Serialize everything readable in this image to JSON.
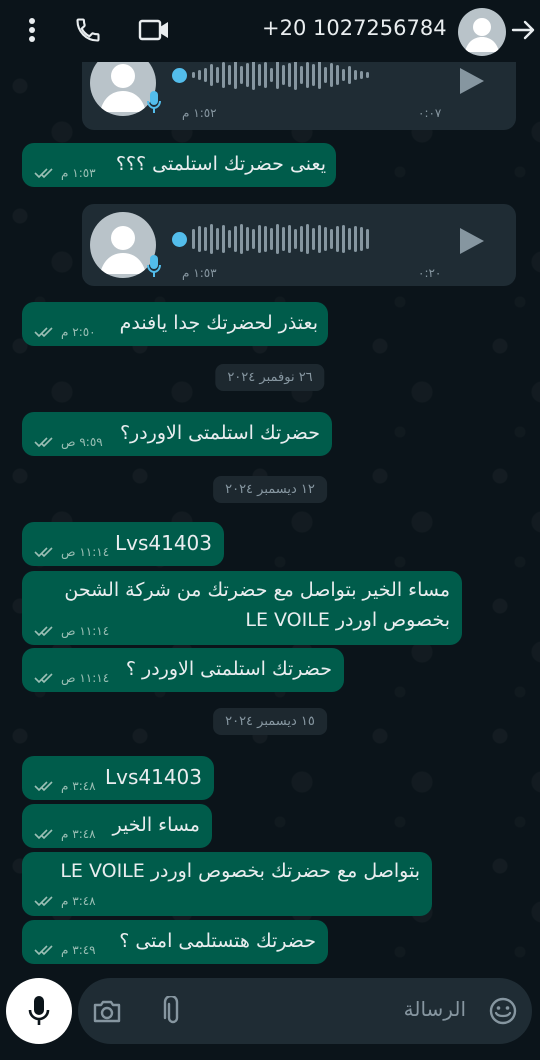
{
  "header": {
    "phone_number": "+20 1027256784",
    "icons": [
      "more-vert-icon",
      "phone-icon",
      "video-icon",
      "avatar",
      "arrow-icon"
    ]
  },
  "messages": {
    "voice1": {
      "duration": "٠:٠٧",
      "time": "١:٥٢ م"
    },
    "m1": {
      "text": "يعنى حضرتك استلمتى ؟؟؟",
      "time": "١:٥٣ م"
    },
    "voice2": {
      "duration": "٠:٢٠",
      "time": "١:٥٣ م"
    },
    "m2": {
      "text": "بعتذر لحضرتك جدا يافندم",
      "time": "٢:٥٠ م"
    },
    "date1": "٢٦ نوفمبر ٢٠٢٤",
    "m3": {
      "text": "حضرتك استلمتى الاوردر؟",
      "time": "٩:٥٩ ص"
    },
    "date2": "١٢ ديسمبر ٢٠٢٤",
    "m4": {
      "text": "Lvs41403",
      "time": "١١:١٤ ص"
    },
    "m5": {
      "line1": "مساء الخير بتواصل مع حضرتك من شركة الشحن",
      "line2": "بخصوص اوردر LE VOILE",
      "time": "١١:١٤ ص"
    },
    "m6": {
      "text": "حضرتك استلمتى الاوردر ؟",
      "time": "١١:١٤ ص"
    },
    "date3": "١٥ ديسمبر ٢٠٢٤",
    "m7": {
      "text": "Lvs41403",
      "time": "٣:٤٨ م"
    },
    "m8": {
      "text": "مساء الخير",
      "time": "٣:٤٨ م"
    },
    "m9": {
      "text": "بتواصل مع حضرتك بخصوص اوردر LE VOILE",
      "time": "٣:٤٨ م"
    },
    "m10": {
      "text": "حضرتك هتستلمى امتى ؟",
      "time": "٣:٤٩ م"
    }
  },
  "composer": {
    "placeholder": "الرسالة",
    "icons": [
      "emoji-icon",
      "attach-icon",
      "camera-icon",
      "mic-icon"
    ]
  },
  "colors": {
    "background": "#0b141a",
    "outgoing_bubble": "#005c4b",
    "voice_bubble": "#1f2c34",
    "read_ticks": "#9bbfb5",
    "accent_blue": "#53bdeb"
  }
}
